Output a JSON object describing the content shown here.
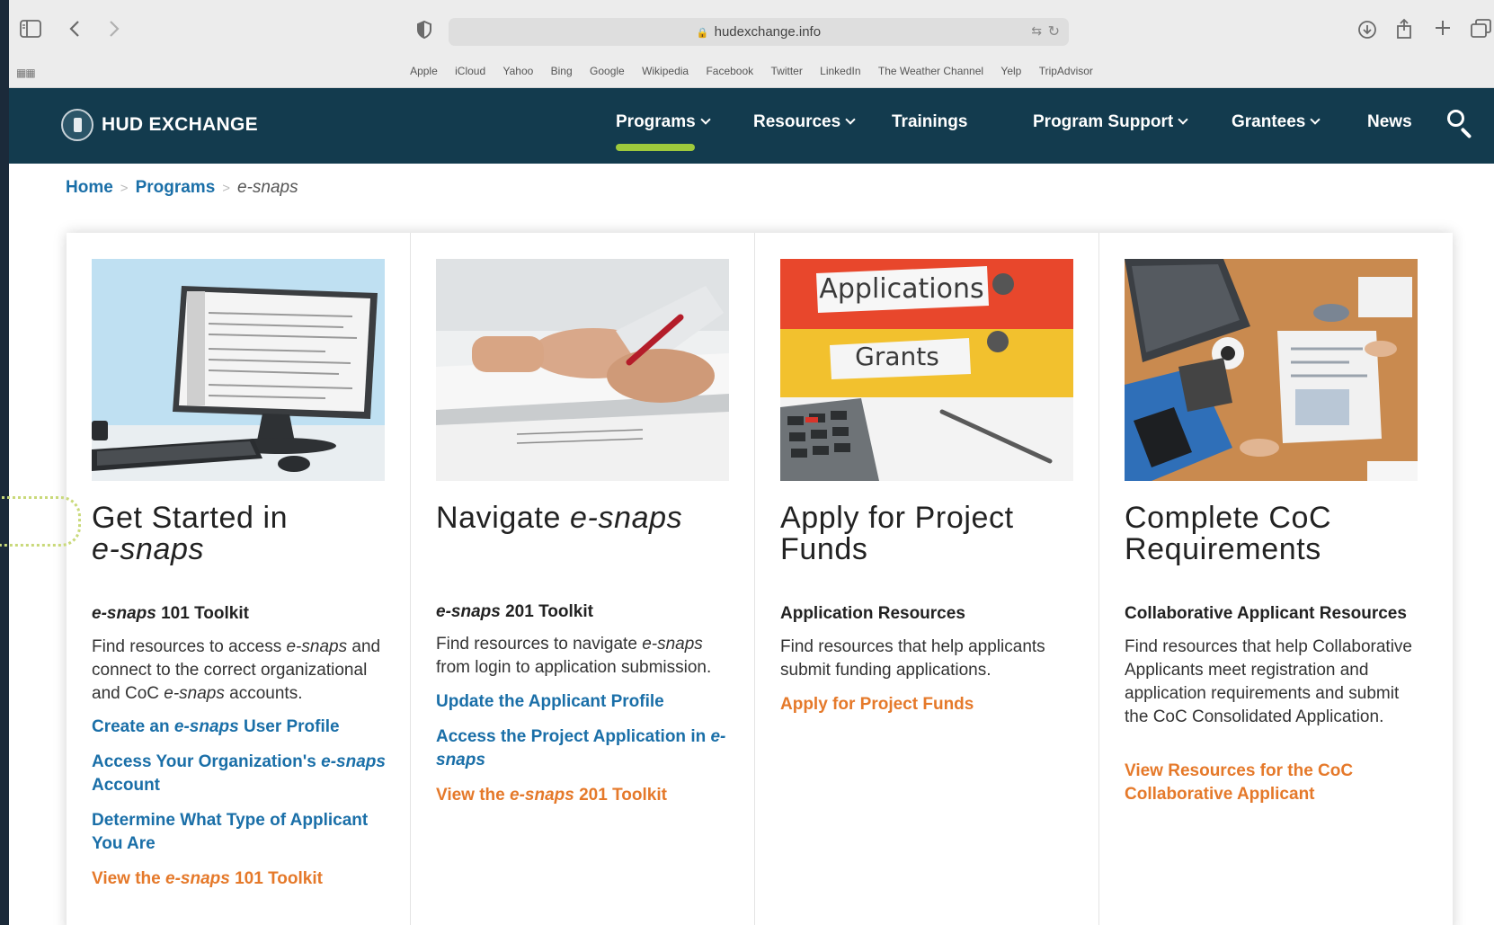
{
  "browser": {
    "url": "hudexchange.info",
    "favorites": [
      "Apple",
      "iCloud",
      "Yahoo",
      "Bing",
      "Google",
      "Wikipedia",
      "Facebook",
      "Twitter",
      "LinkedIn",
      "The Weather Channel",
      "Yelp",
      "TripAdvisor"
    ]
  },
  "site": {
    "logo": "HUD EXCHANGE",
    "nav": {
      "programs": "Programs",
      "resources": "Resources",
      "trainings": "Trainings",
      "program_support": "Program Support",
      "grantees": "Grantees",
      "news": "News"
    },
    "active_nav": "Programs",
    "accent_color": "#9ec93c",
    "nav_bg": "#133b4e"
  },
  "breadcrumb": {
    "home": "Home",
    "programs": "Programs",
    "current": "e-snaps"
  },
  "cards": [
    {
      "title_a": "Get Started in",
      "title_b": "e-snaps",
      "toolkit_italic": "e-snaps",
      "toolkit_rest": " 101 Toolkit",
      "desc_1": "Find resources to access ",
      "desc_2": "e-snaps",
      "desc_3": " and connect to the correct organizational and CoC ",
      "desc_4": "e-snaps",
      "desc_5": " accounts.",
      "link1_a": "Create an ",
      "link1_b": "e-snaps",
      "link1_c": " User Profile",
      "link2_a": "Access Your Organization's ",
      "link2_b": "e-snaps",
      "link2_c": " Account",
      "link3": "Determine What Type of Applicant You Are",
      "link4_a": "View the ",
      "link4_b": "e-snaps",
      "link4_c": " 101 Toolkit"
    },
    {
      "title_a": "Navigate ",
      "title_b": "e-snaps",
      "toolkit_italic": "e-snaps",
      "toolkit_rest": " 201 Toolkit",
      "desc_1": "Find resources to navigate ",
      "desc_2": "e-snaps",
      "desc_3": " from login to application submission.",
      "link1": "Update the Applicant Profile",
      "link2_a": "Access the Project Application in ",
      "link2_b": "e-snaps",
      "link3_a": "View the ",
      "link3_b": "e-snaps",
      "link3_c": " 201 Toolkit"
    },
    {
      "title": "Apply for Project Funds",
      "subhead": "Application Resources",
      "desc": "Find resources that help applicants submit funding applications.",
      "link1": "Apply for Project Funds",
      "photo_label_1": "Applications",
      "photo_label_2": "Grants"
    },
    {
      "title": "Complete CoC Requirements",
      "subhead": "Collaborative Applicant Resources",
      "desc": "Find resources that help Collaborative Applicants meet registration and application requirements and submit the CoC Consolidated Application.",
      "link1": "View Resources for the CoC Collaborative Applicant"
    }
  ]
}
